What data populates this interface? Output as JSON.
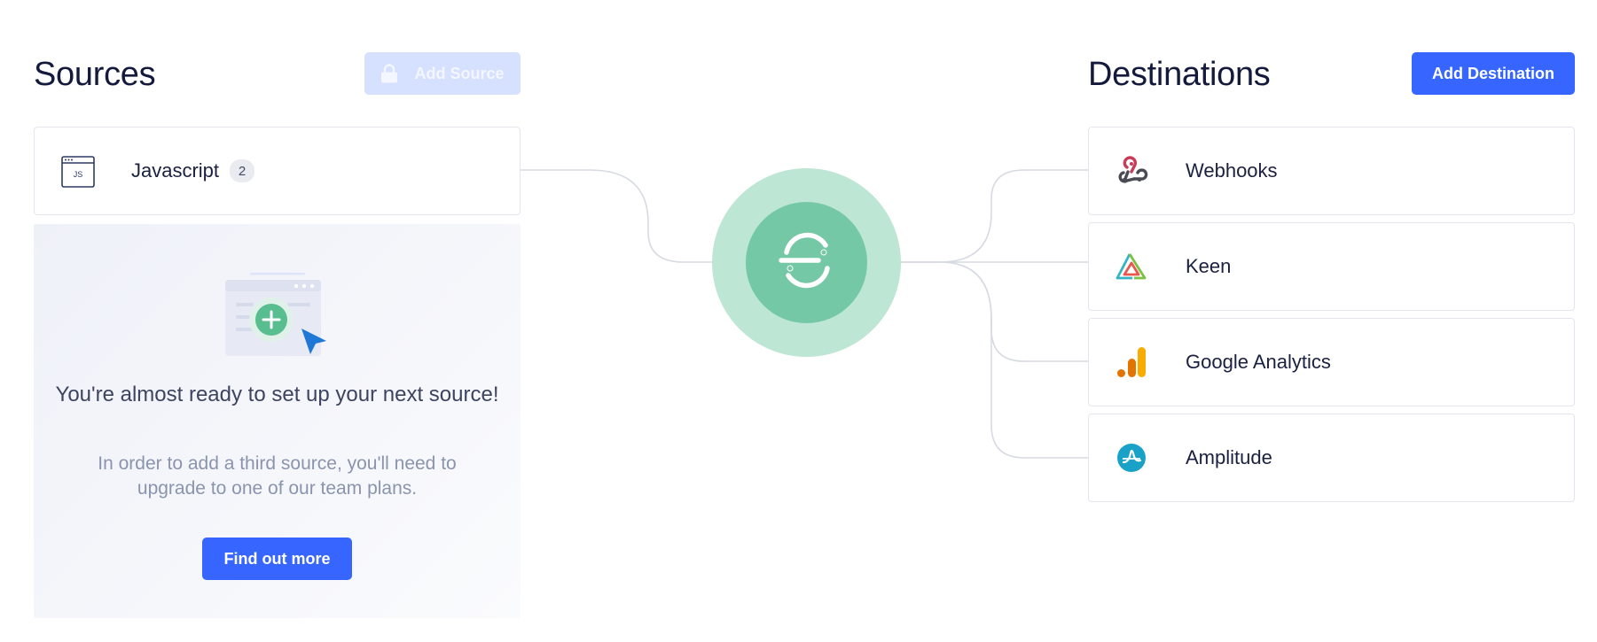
{
  "sources": {
    "heading": "Sources",
    "add_button_label": "Add Source",
    "items": [
      {
        "label": "Javascript",
        "count": "2",
        "icon": "js-window-icon"
      }
    ],
    "upgrade": {
      "title": "You're almost ready to set up your next source!",
      "text": "In order to add a third source, you'll need to upgrade to one of our team plans.",
      "button_label": "Find out more"
    }
  },
  "destinations": {
    "heading": "Destinations",
    "add_button_label": "Add Destination",
    "items": [
      {
        "label": "Webhooks",
        "icon": "webhooks-icon"
      },
      {
        "label": "Keen",
        "icon": "keen-icon"
      },
      {
        "label": "Google Analytics",
        "icon": "google-analytics-icon"
      },
      {
        "label": "Amplitude",
        "icon": "amplitude-icon"
      }
    ]
  },
  "hub": {
    "icon": "segment-logo-icon"
  },
  "colors": {
    "primary": "#3765ff",
    "primary_disabled": "#d6e0ff",
    "hub_outer": "#bde6d4",
    "hub_inner": "#75c8a6",
    "connector": "#d7dae2"
  }
}
